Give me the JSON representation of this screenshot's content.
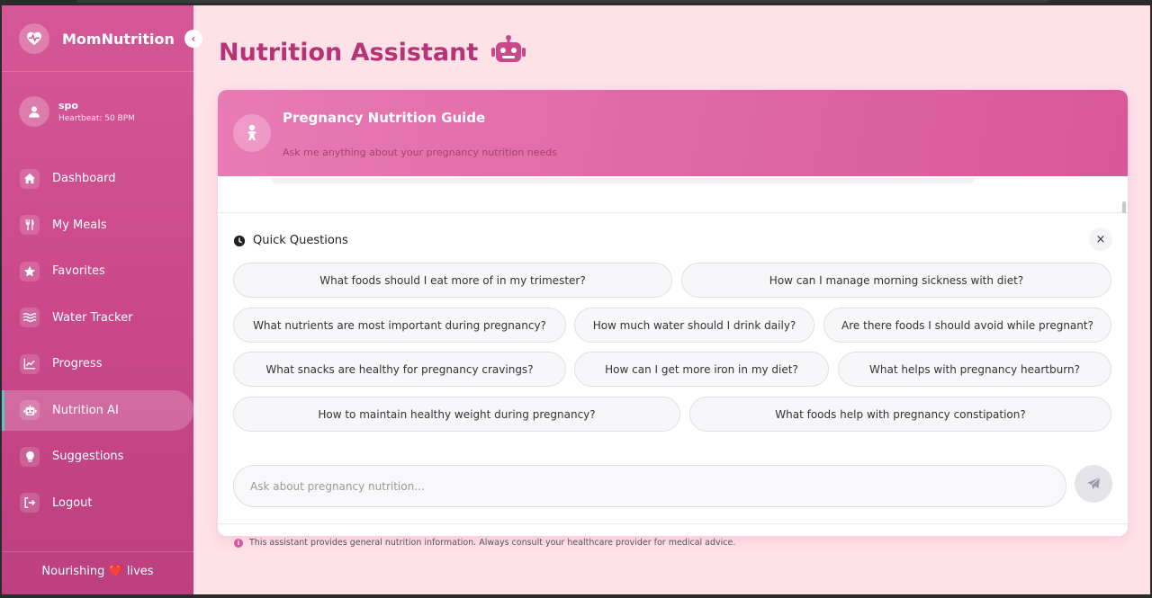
{
  "brand": {
    "name": "MomNutrition",
    "icon": "heart-pulse-icon"
  },
  "user": {
    "name": "spo",
    "heartbeat": "Heartbeat: 50 BPM"
  },
  "sidebar": {
    "collapse_glyph": "‹",
    "items": [
      {
        "label": "Dashboard",
        "icon": "home-icon"
      },
      {
        "label": "My Meals",
        "icon": "utensils-icon"
      },
      {
        "label": "Favorites",
        "icon": "star-icon"
      },
      {
        "label": "Water Tracker",
        "icon": "water-icon"
      },
      {
        "label": "Progress",
        "icon": "chart-line-icon"
      },
      {
        "label": "Nutrition AI",
        "icon": "robot-icon",
        "active": true
      },
      {
        "label": "Suggestions",
        "icon": "lightbulb-icon"
      },
      {
        "label": "Logout",
        "icon": "logout-icon"
      }
    ],
    "footer_left": "Nourishing",
    "footer_heart": "❤️",
    "footer_right": "lives"
  },
  "page": {
    "title": "Nutrition Assistant"
  },
  "guide": {
    "title": "Pregnancy Nutrition Guide",
    "subtitle": "Ask me anything about your pregnancy nutrition needs"
  },
  "quick": {
    "title": "Quick Questions",
    "close": "×",
    "questions": [
      "What foods should I eat more of in my trimester?",
      "How can I manage morning sickness with diet?",
      "What nutrients are most important during pregnancy?",
      "How much water should I drink daily?",
      "Are there foods I should avoid while pregnant?",
      "What snacks are healthy for pregnancy cravings?",
      "How can I get more iron in my diet?",
      "What helps with pregnancy heartburn?",
      "How to maintain healthy weight during pregnancy?",
      "What foods help with pregnancy constipation?"
    ]
  },
  "chat": {
    "placeholder": "Ask about pregnancy nutrition..."
  },
  "disclaimer": {
    "info_glyph": "i",
    "text": "This assistant provides general nutrition information. Always consult your healthcare provider for medical advice."
  },
  "colors": {
    "accent": "#c9478a",
    "title": "#b63376",
    "background": "#ffe1e8",
    "active_marker": "#5fc3c1"
  }
}
